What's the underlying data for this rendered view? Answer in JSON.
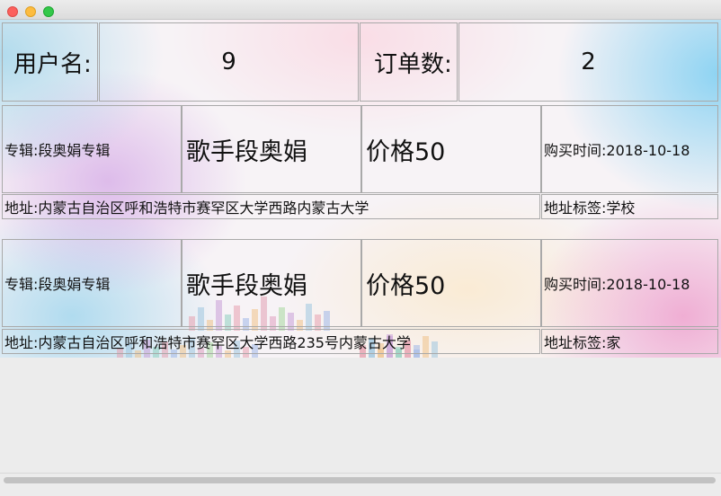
{
  "summary": {
    "username_label": "用户名:",
    "username_value": "9",
    "order_count_label": "订单数:",
    "order_count_value": "2"
  },
  "orders": [
    {
      "album": "专辑:段奥娟专辑",
      "singer": "歌手段奥娟",
      "price": "价格50",
      "purchase_time": "购买时间:2018-10-18",
      "address": "地址:内蒙古自治区呼和浩特市赛罕区大学西路内蒙古大学",
      "address_tag": "地址标签:学校"
    },
    {
      "album": "专辑:段奥娟专辑",
      "singer": "歌手段奥娟",
      "price": "价格50",
      "purchase_time": "购买时间:2018-10-18",
      "address": "地址:内蒙古自治区呼和浩特市赛罕区大学西路235号内蒙古大学",
      "address_tag": "地址标签:家"
    }
  ]
}
